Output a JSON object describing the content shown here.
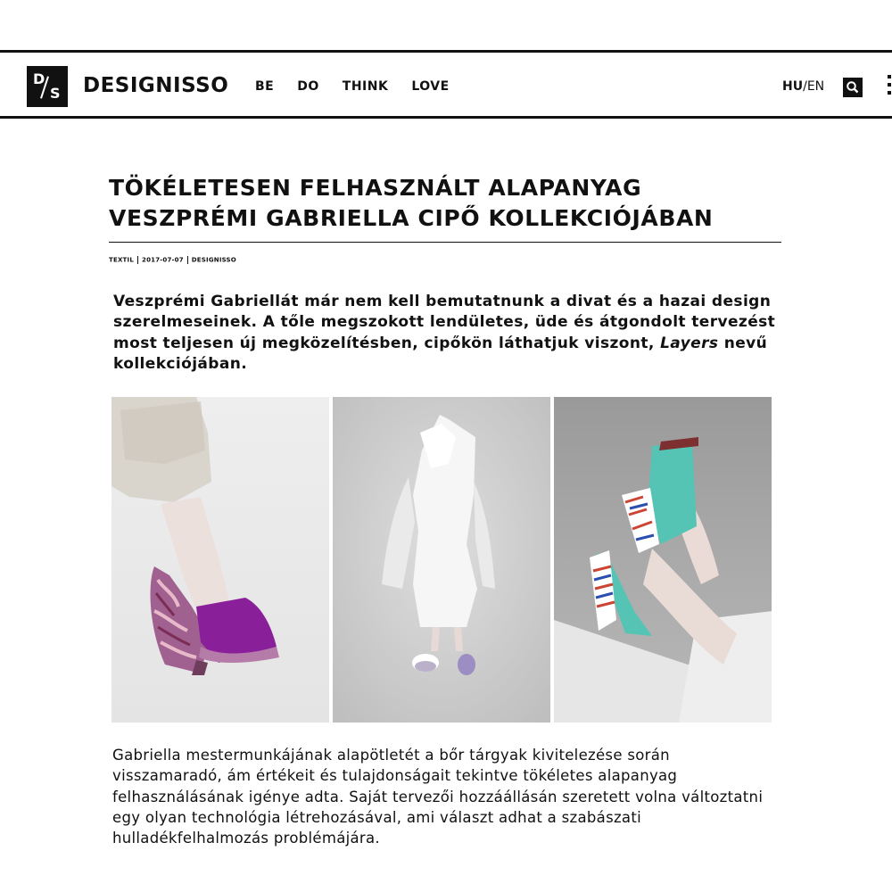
{
  "header": {
    "logo_text": "D/S",
    "brand": "DESIGNISSO",
    "nav": [
      "BE",
      "DO",
      "THINK",
      "LOVE"
    ],
    "lang_hu": "HU",
    "lang_sep": "/",
    "lang_en": "EN",
    "search_icon": "search-icon",
    "menu_icon": "menu-icon"
  },
  "article": {
    "title": "TÖKÉLETESEN FELHASZNÁLT ALAPANYAG VESZPRÉMI GABRIELLA CIPŐ KOLLEKCIÓJÁBAN",
    "meta": {
      "category": "TEXTIL",
      "date": "2017-07-07",
      "author": "DESIGNISSO"
    },
    "lead_before": "Veszprémi Gabriellát már nem kell bemutatnunk a divat és a hazai design szerelmeseinek. A tőle megszokott lendületes, üde és átgondolt tervezést most teljesen új megközelítésben, cipőkön láthatjuk viszont, ",
    "lead_italic": "Layers",
    "lead_after": " nevű kollekciójában.",
    "body": "Gabriella mestermunkájának alapötletét a bőr tárgyak kivitelezése során visszamaradó, ám értékeit és tulajdonságait tekintve tökéletes alapanyag felhasználásának igénye adta. Saját tervezői hozzáállásán szeretett volna változtatni egy olyan technológia létrehozásával, ami választ adhat a szabászati hulladékfelhalmozás problémájára."
  },
  "colors": {
    "ink": "#111111",
    "purple_suede": "#8a1f9a",
    "turquoise_suede": "#55c4b4"
  }
}
